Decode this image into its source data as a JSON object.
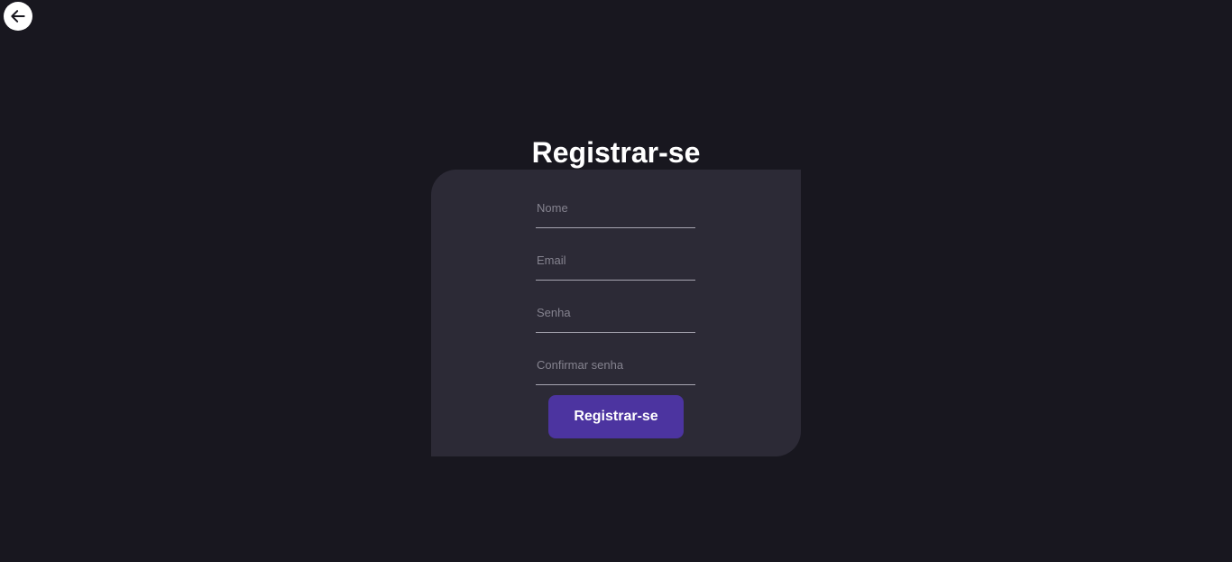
{
  "header": {
    "back_icon": "arrow-left-icon"
  },
  "page": {
    "title": "Registrar-se"
  },
  "form": {
    "nome_placeholder": "Nome",
    "email_placeholder": "Email",
    "senha_placeholder": "Senha",
    "confirmar_senha_placeholder": "Confirmar senha",
    "submit_label": "Registrar-se"
  },
  "colors": {
    "background": "#18171f",
    "card": "#2c2a36",
    "accent": "#4c34a0",
    "text": "#ffffff"
  }
}
